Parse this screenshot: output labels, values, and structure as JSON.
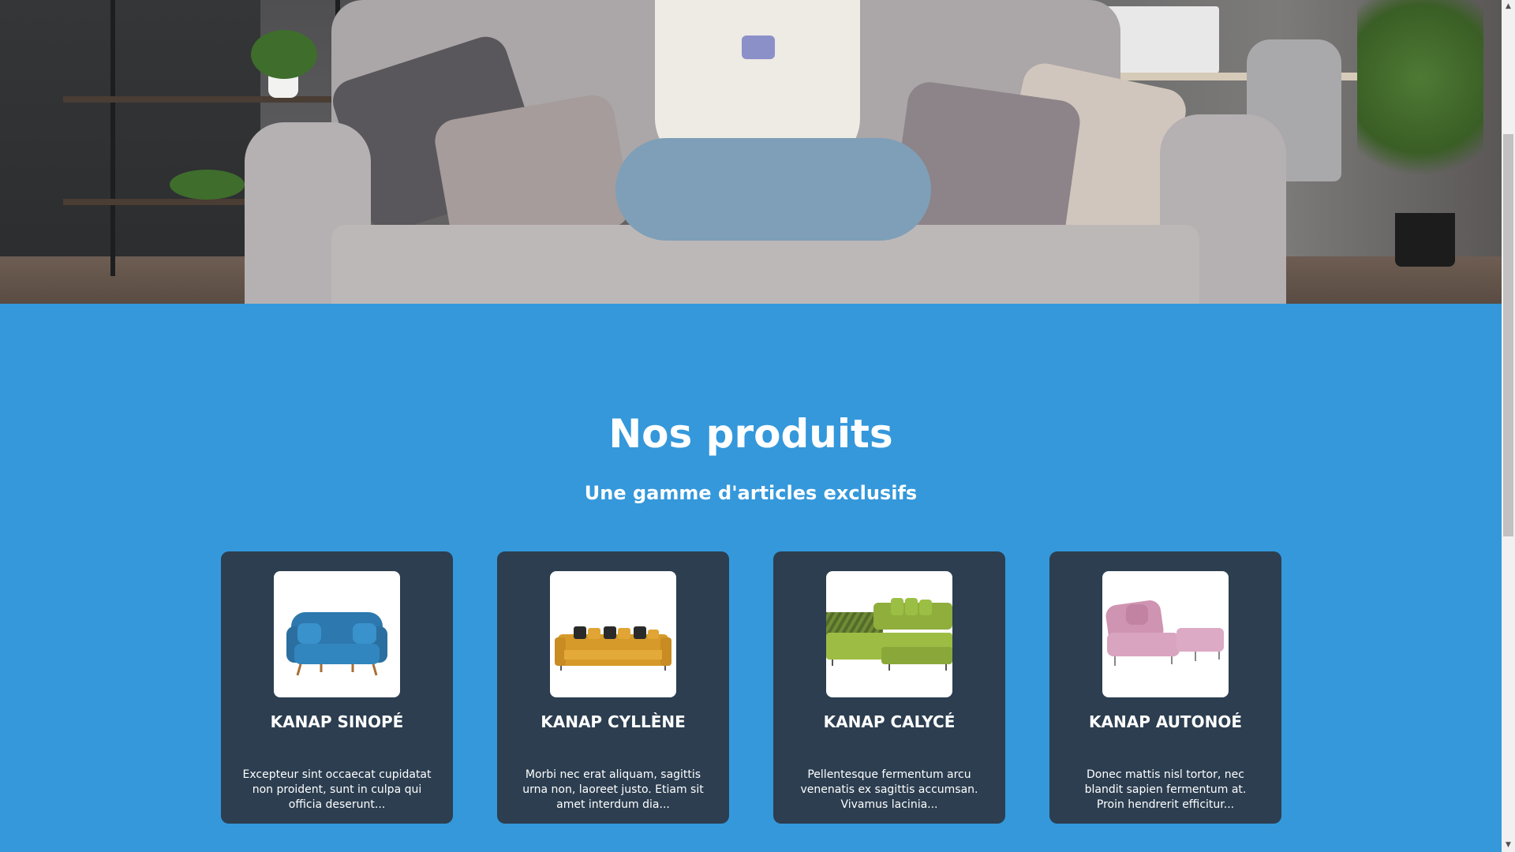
{
  "hero": {
    "image_alt": "Femme assise sur un canapé gris avec un téléphone"
  },
  "products": {
    "title": "Nos produits",
    "subtitle": "Une gamme d'articles exclusifs",
    "items": [
      {
        "name": "KANAP SINOPÉ",
        "description": "Excepteur sint occaecat cupidatat non proident, sunt in culpa qui officia deserunt...",
        "color": "#2f7bb2",
        "icon": "sofa-blue-image"
      },
      {
        "name": "KANAP CYLLÈNE",
        "description": "Morbi nec erat aliquam, sagittis urna non, laoreet justo. Etiam sit amet interdum dia...",
        "color": "#d99a2b",
        "icon": "sofa-yellow-image"
      },
      {
        "name": "KANAP CALYCÉ",
        "description": "Pellentesque fermentum arcu venenatis ex sagittis accumsan. Vivamus lacinia...",
        "color": "#8aa83a",
        "icon": "sofa-green-image"
      },
      {
        "name": "KANAP AUTONOÉ",
        "description": "Donec mattis nisl tortor, nec blandit sapien fermentum at. Proin hendrerit efficitur...",
        "color": "#d8a2bd",
        "icon": "sofa-pink-image"
      }
    ]
  },
  "colors": {
    "section_background": "#3498db",
    "card_background": "#2c3e50",
    "text": "#ffffff"
  },
  "scrollbar": {
    "up_arrow": "▲",
    "down_arrow": "▼"
  }
}
